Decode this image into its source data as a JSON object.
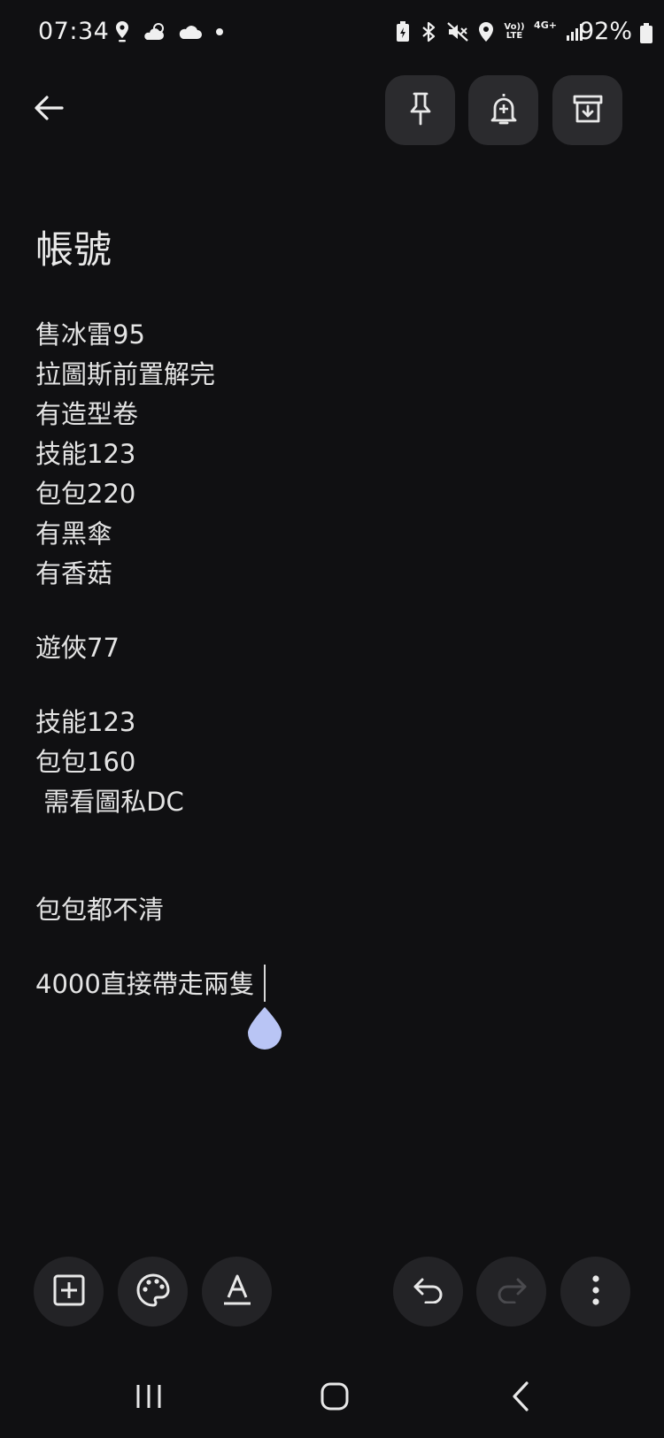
{
  "status_bar": {
    "time": "07:34",
    "left_icons": [
      "location-pin-icon",
      "partly-cloudy-icon",
      "cloud-icon",
      "dot-icon"
    ],
    "right_icons": [
      "battery-saver-icon",
      "bluetooth-icon",
      "mute-icon",
      "location-icon",
      "volte-icon",
      "4g-icon",
      "signal-icon"
    ],
    "volte_label": "Vo))\nLTE",
    "network_label": "4G+",
    "battery": "92%"
  },
  "top_bar": {
    "back_icon": "arrow-back-icon",
    "actions": [
      "pin-icon",
      "reminder-bell-icon",
      "archive-icon"
    ]
  },
  "note": {
    "title": "帳號",
    "lines": [
      "售冰雷95",
      "拉圖斯前置解完",
      "有造型卷",
      "技能123",
      "包包220",
      "有黑傘",
      "有香菇",
      "遊俠77",
      "技能123",
      "包包160",
      " 需看圖私DC",
      "包包都不清",
      "4000直接帶走兩隻"
    ]
  },
  "bottom_toolbar": {
    "left": [
      "add-box-icon",
      "palette-icon",
      "text-format-icon"
    ],
    "right": [
      "undo-icon",
      "redo-icon",
      "more-vert-icon"
    ]
  },
  "nav_bar": [
    "recent-apps-icon",
    "home-icon",
    "back-icon"
  ],
  "colors": {
    "background": "#101012",
    "button_bg": "#2b2b2e",
    "cursor_handle": "#b9c5f5"
  }
}
